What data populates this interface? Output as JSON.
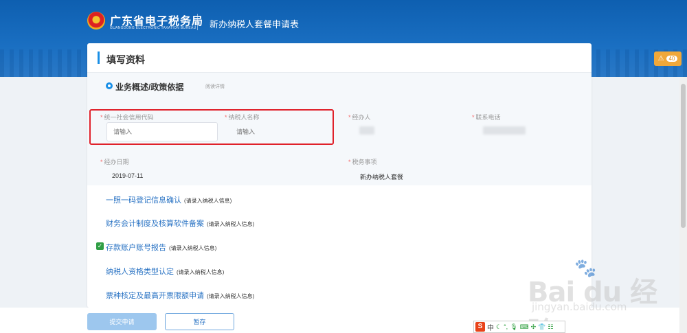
{
  "header": {
    "brand_cn": "广东省电子税务局",
    "brand_en": "GUANGDONG ELECTRONIC TAXATION BUREAU",
    "page_title": "新办纳税人套餐申请表",
    "warning_count": "40"
  },
  "card": {
    "title": "填写资料",
    "section_label": "业务概述/政策依据",
    "section_link": "阅读详情"
  },
  "form": {
    "credit_code_label": "统一社会信用代码",
    "credit_code_placeholder": "请输入",
    "taxpayer_name_label": "纳税人名称",
    "taxpayer_name_placeholder": "请输入",
    "handler_label": "经办人",
    "phone_label": "联系电话",
    "date_label": "经办日期",
    "date_value": "2019-07-11",
    "tax_matter_label": "税务事项",
    "tax_matter_value": "新办纳税人套餐"
  },
  "items": [
    {
      "label": "一照一码登记信息确认",
      "hint": "(请录入纳税人信息)",
      "checked": false
    },
    {
      "label": "财务会计制度及核算软件备案",
      "hint": "(请录入纳税人信息)",
      "checked": false
    },
    {
      "label": "存款账户账号报告",
      "hint": "(请录入纳税人信息)",
      "checked": true
    },
    {
      "label": "纳税人资格类型认定",
      "hint": "(请录入纳税人信息)",
      "checked": false
    },
    {
      "label": "票种核定及最高开票限额申请",
      "hint": "(请录入纳税人信息)",
      "checked": false
    }
  ],
  "footer": {
    "submit_label": "提交申请",
    "save_label": "暂存"
  },
  "ime": {
    "logo": "S",
    "mode": "中"
  },
  "watermark": {
    "brand": "Bai du 经验",
    "url": "jingyan.baidu.com"
  },
  "colors": {
    "header_blue": "#1a6fc2",
    "accent_blue": "#1a8fe6",
    "link_blue": "#2b74c4",
    "warning": "#f0a83a",
    "highlight_red": "#e0212a",
    "check_green": "#2f9e44"
  }
}
